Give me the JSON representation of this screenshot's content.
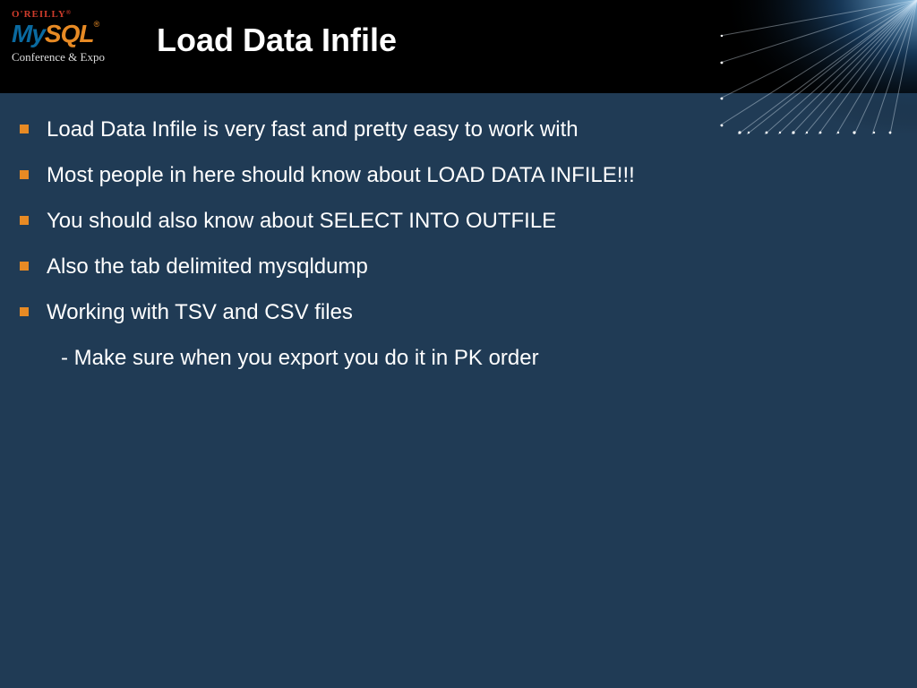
{
  "header": {
    "brand": {
      "oreilly": "O'REILLY",
      "mysql_my": "My",
      "mysql_sql": "SQL",
      "conference_expo": "Conference & Expo"
    },
    "title": "Load Data Infile"
  },
  "bullets": [
    {
      "text": "Load Data Infile is very fast and pretty easy to work with"
    },
    {
      "text": "Most people in here should know about LOAD DATA INFILE!!!"
    },
    {
      "text": "You should also know about SELECT INTO OUTFILE"
    },
    {
      "text": "Also the tab delimited mysqldump"
    },
    {
      "text": "Working with TSV and CSV files",
      "sub": "- Make sure when you export you do it in PK order"
    }
  ]
}
